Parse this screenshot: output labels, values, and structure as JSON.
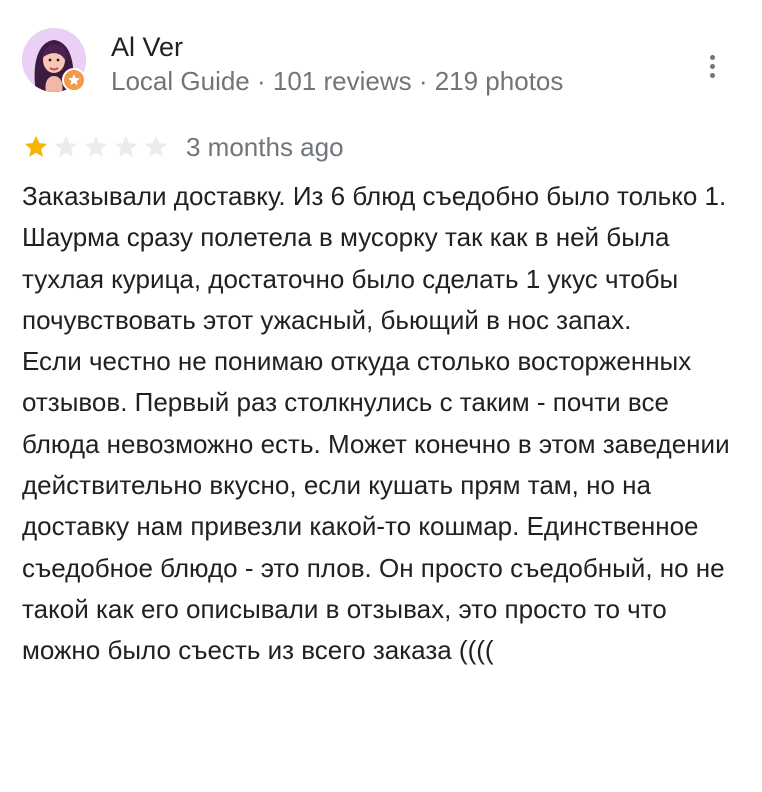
{
  "author": {
    "name": "Al Ver",
    "meta": "Local Guide · 101 reviews · 219 photos",
    "avatar_icon": "avatar-portrait",
    "badge_icon": "local-guide-star-icon"
  },
  "menu": {
    "icon": "more-vert-icon"
  },
  "rating": {
    "value": 1,
    "max": 5,
    "filled_color": "#f5b400",
    "empty_color": "#ececec",
    "date": "3 months ago"
  },
  "review": {
    "paragraph_1": "Заказывали доставку. Из 6 блюд съедобно было только 1. Шаурма сразу полетела в мусорку так как в ней была тухлая курица, достаточно было сделать 1 укус чтобы почувствовать этот ужасный, бьющий в нос запах.",
    "paragraph_2": "Если честно не понимаю откуда столько восторженных отзывов. Первый раз столкнулись с таким - почти все блюда невозможно есть. Может конечно в этом заведении действительно вкусно, если кушать прям там, но на доставку нам привезли какой-то кошмар. Единственное съедобное блюдо - это плов. Он просто съедобный, но не такой  как его описывали в отзывах, это просто то что можно было съесть из всего заказа (((("
  }
}
